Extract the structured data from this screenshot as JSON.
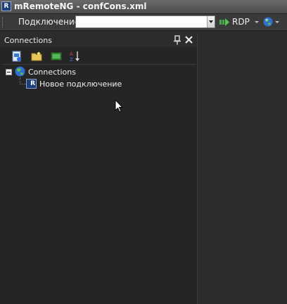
{
  "window": {
    "title": "mRemoteNG - confCons.xml",
    "icon_text": "R"
  },
  "toolbar": {
    "connection_label": "Подключение:",
    "connection_value": "",
    "protocol_label": "RDP",
    "protocol_icon": "rdp-arrow-icon",
    "quick_icon": "globe-icon"
  },
  "panel": {
    "title": "Connections",
    "tools": [
      "new-connection-icon",
      "new-folder-icon",
      "view-icon",
      "sort-az-icon"
    ]
  },
  "tree": {
    "root_label": "Connections",
    "children": [
      {
        "label": "Новое подключение",
        "icon_text": "R"
      }
    ]
  },
  "colors": {
    "background": "#2c2c2c",
    "panel": "#252525",
    "accent_blue": "#1e3f7a"
  }
}
